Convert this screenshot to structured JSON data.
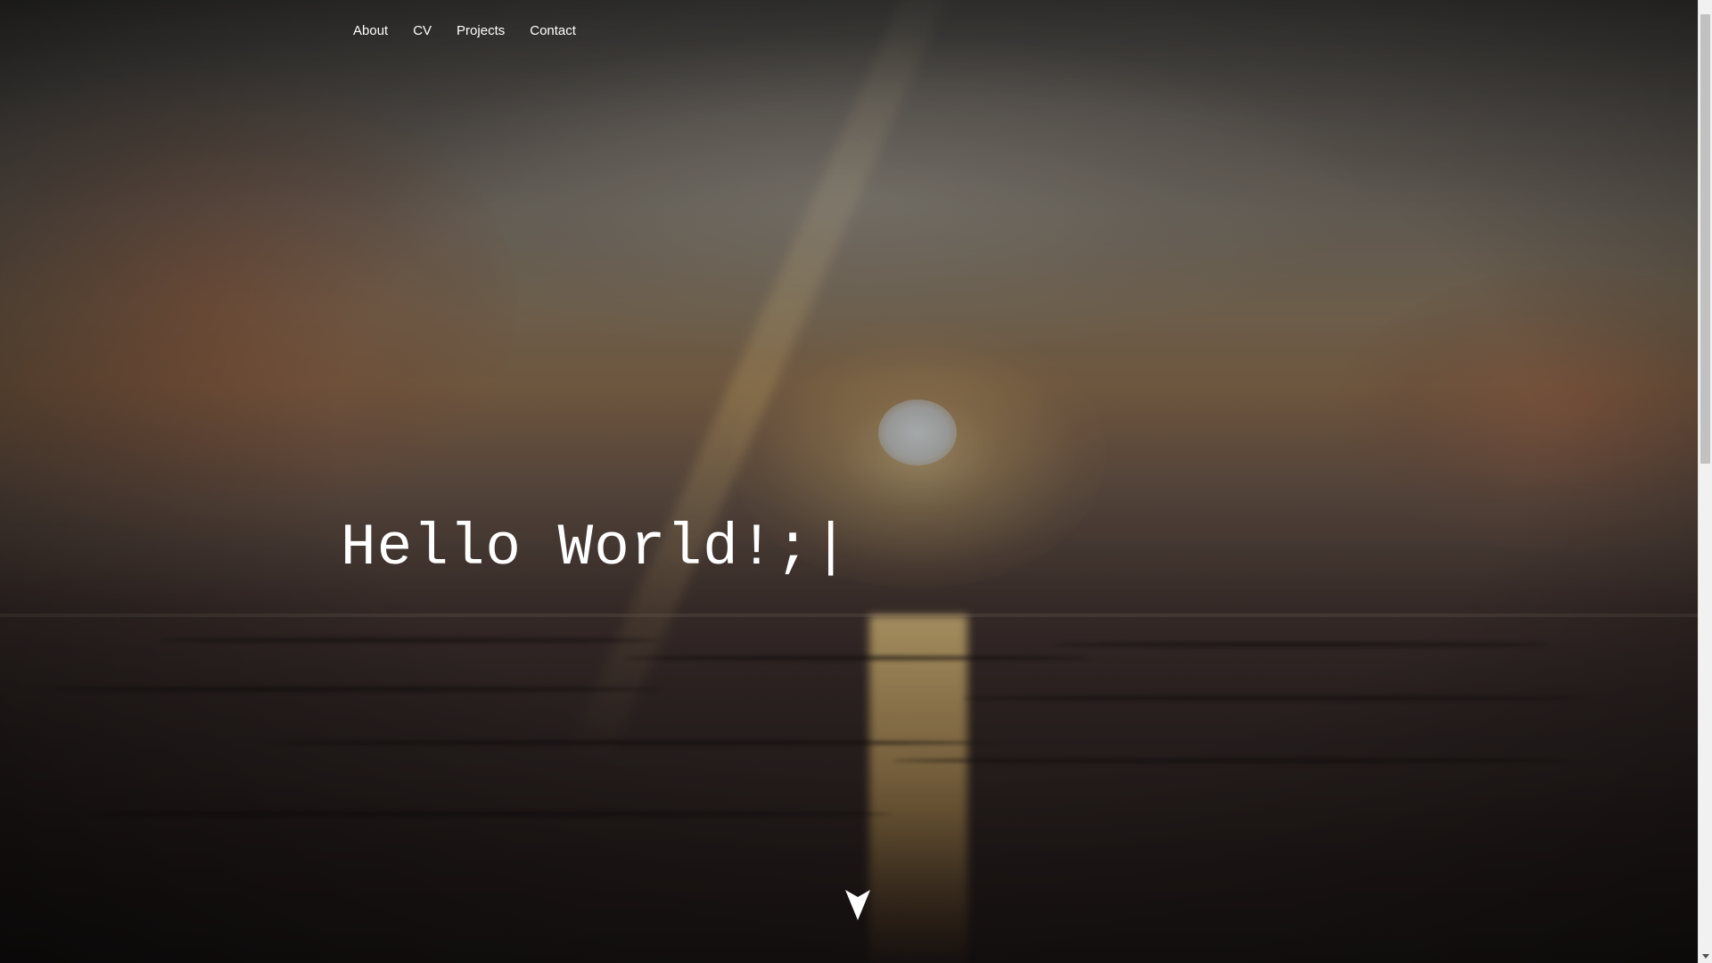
{
  "nav": {
    "items": [
      {
        "label": "About"
      },
      {
        "label": "CV"
      },
      {
        "label": "Projects"
      },
      {
        "label": "Contact"
      }
    ]
  },
  "hero": {
    "title": "Hello World!;",
    "cursor": "|",
    "scroll_icon": "chevron-down-arrow-icon"
  },
  "colors": {
    "text": "#ffffff",
    "scrollbar_track": "#f1f1f1",
    "scrollbar_thumb": "#c1c1c1"
  }
}
